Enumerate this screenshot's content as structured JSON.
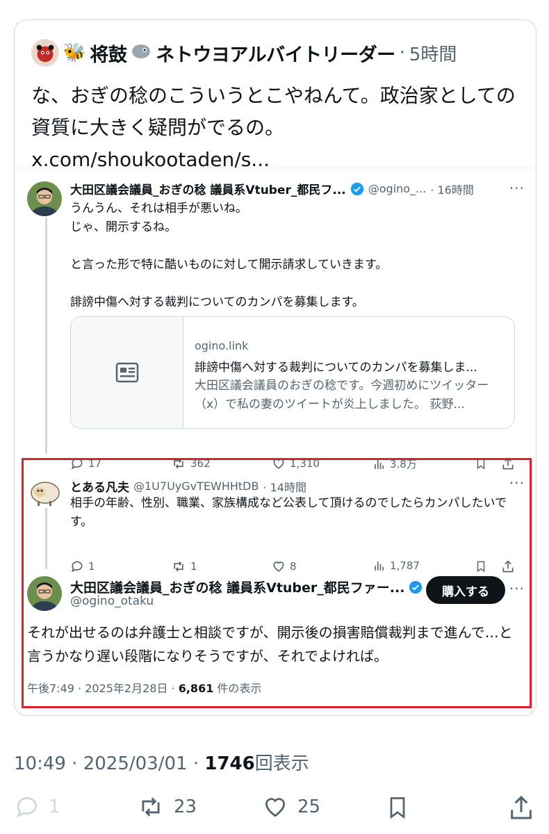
{
  "quote": {
    "author_name": "将鼓",
    "author_name_2": "ネトウヨアルバイトリーダー",
    "separator": "·",
    "time": "5時間",
    "text": "な、おぎの稔のこういうとこやねんて。政治家としての資質に大きく疑問がでるの。 x.com/shoukootaden/s..."
  },
  "embedded_post": {
    "author_name": "大田区議会議員_おぎの稔 議員系Vtuber_都民フ...",
    "handle": "@ogino_...",
    "time": "· 16時間",
    "more": "···",
    "text": "うんうん、それは相手が悪いね。\nじゃ、開示するね。\n\nと言った形で特に酷いものに対して開示請求していきます。\n\n誹謗中傷へ対する裁判についてのカンパを募集します。",
    "link_card": {
      "domain": "ogino.link",
      "title": "誹謗中傷へ対する裁判についてのカンパを募集しま...",
      "description": "大田区議会議員のおぎの稔です。今週初めにツイッター（x）で私の妻のツイートが炎上しました。 荻野..."
    },
    "actions": {
      "replies": "17",
      "reposts": "362",
      "likes": "1,310",
      "views": "3.8万"
    }
  },
  "reply_post": {
    "author_name": "とある凡夫",
    "handle": "@1U7UyGvTEWHHtDB",
    "time": "· 14時間",
    "more": "···",
    "text": "相手の年齢、性別、職業、家族構成など公表して頂けるのでしたらカンパしたいです。",
    "actions": {
      "replies": "1",
      "reposts": "1",
      "likes": "8",
      "views": "1,787"
    }
  },
  "main_post": {
    "author_name": "大田区議会議員_おぎの稔 議員系Vtuber_都民ファー...",
    "handle": "@ogino_otaku",
    "buy_label": "購入する",
    "more": "···",
    "text": "それが出せるのは弁護士と相談ですが、開示後の損害賠償裁判まで進んで…と言うかなり遅い段階になりそうですが、それでよければ。",
    "meta_time": "午後7:49 · 2025年2月28日 · ",
    "meta_views": "6,861",
    "meta_views_label": " 件の表示"
  },
  "footer": {
    "timestamp": "10:49 · 2025/03/01 · ",
    "views": "1746",
    "views_label": "回表示",
    "actions": {
      "replies": "1",
      "reposts": "23",
      "likes": "25"
    }
  },
  "colors": {
    "highlight": "#e0202a",
    "verified": "#1d9bf0",
    "muted": "#536471"
  }
}
